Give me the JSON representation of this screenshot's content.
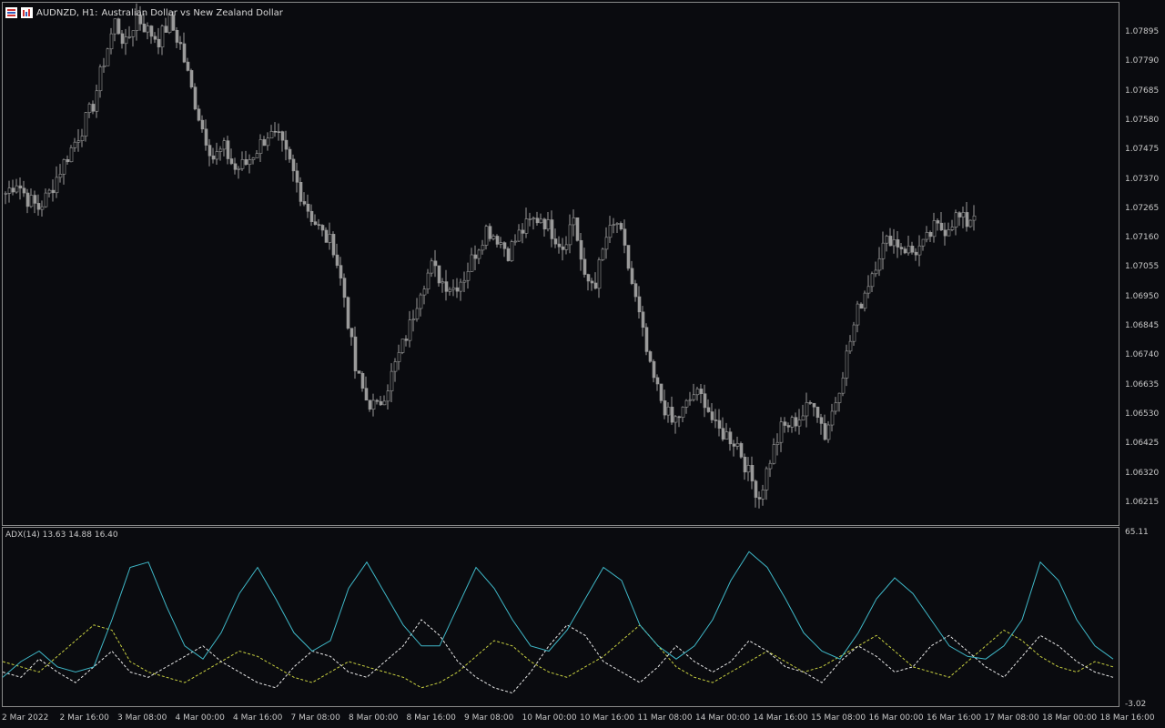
{
  "chart_header": {
    "symbol_timeframe": "AUDNZD, H1:",
    "description": "Australian Dollar vs New Zealand Dollar"
  },
  "icons": [
    "symbol-list-icon",
    "chart-type-icon"
  ],
  "colors": {
    "background": "#0a0b0f",
    "candles": "#9a9a9a",
    "adx_line": "#3fb8c8",
    "plus_di": "#e8e8e8",
    "minus_di": "#c8d040",
    "border": "#8a8a8a"
  },
  "indicator": {
    "label": "ADX(14) 13.63 14.88 16.40",
    "scale_top": "65.11",
    "scale_bottom": "-3.02"
  },
  "price_axis": [
    "1.07895",
    "1.07790",
    "1.07685",
    "1.07580",
    "1.07475",
    "1.07370",
    "1.07265",
    "1.07160",
    "1.07055",
    "1.06950",
    "1.06845",
    "1.06740",
    "1.06635",
    "1.06530",
    "1.06425",
    "1.06320",
    "1.06215"
  ],
  "time_axis": [
    "2 Mar 2022",
    "2 Mar 16:00",
    "3 Mar 08:00",
    "4 Mar 00:00",
    "4 Mar 16:00",
    "7 Mar 08:00",
    "8 Mar 00:00",
    "8 Mar 16:00",
    "9 Mar 08:00",
    "10 Mar 00:00",
    "10 Mar 16:00",
    "11 Mar 08:00",
    "14 Mar 00:00",
    "14 Mar 16:00",
    "15 Mar 08:00",
    "16 Mar 00:00",
    "16 Mar 16:00",
    "17 Mar 08:00",
    "18 Mar 00:00",
    "18 Mar 16:00"
  ],
  "chart_data": {
    "type": "line",
    "series": [
      {
        "values": [
          1.073,
          1.0734,
          1.0728,
          1.0725,
          1.073,
          1.0738,
          1.0745,
          1.0752,
          1.076,
          1.0775,
          1.0788,
          1.078,
          1.079,
          1.0785,
          1.0782,
          1.0788,
          1.078,
          1.0765,
          1.0752,
          1.0742,
          1.0745,
          1.0738,
          1.074,
          1.0745,
          1.075,
          1.0748,
          1.074,
          1.073,
          1.0722,
          1.0716,
          1.0712,
          1.0695,
          1.067,
          1.066,
          1.0657,
          1.0665,
          1.0675,
          1.0685,
          1.0698,
          1.0705,
          1.07,
          1.0698,
          1.0702,
          1.071,
          1.0718,
          1.0715,
          1.071,
          1.0716,
          1.072,
          1.0722,
          1.0717,
          1.0712,
          1.0722,
          1.07,
          1.07,
          1.0715,
          1.072,
          1.0705,
          1.0688,
          1.067,
          1.066,
          1.0652,
          1.0656,
          1.0662,
          1.066,
          1.065,
          1.0648,
          1.0645,
          1.0635,
          1.0627,
          1.064,
          1.065,
          1.0652,
          1.0655,
          1.066,
          1.0648,
          1.066,
          1.0675,
          1.069,
          1.07,
          1.071,
          1.0715,
          1.0712,
          1.071,
          1.0712,
          1.0718,
          1.0718,
          1.0722,
          1.072,
          1.0725
        ]
      },
      {
        "name": "ADX",
        "values": [
          8,
          14,
          18,
          12,
          10,
          12,
          30,
          50,
          52,
          35,
          20,
          15,
          25,
          40,
          50,
          38,
          25,
          18,
          22,
          42,
          52,
          40,
          28,
          20,
          20,
          35,
          50,
          42,
          30,
          20,
          18,
          26,
          38,
          50,
          45,
          28,
          20,
          15,
          20,
          30,
          45,
          56,
          50,
          38,
          25,
          18,
          15,
          25,
          38,
          46,
          40,
          30,
          20,
          16,
          15,
          20,
          30,
          52,
          45,
          30,
          20,
          15
        ]
      },
      {
        "name": "+DI",
        "values": [
          10,
          8,
          15,
          10,
          6,
          12,
          18,
          10,
          8,
          12,
          16,
          20,
          14,
          10,
          6,
          4,
          12,
          18,
          16,
          10,
          8,
          14,
          20,
          30,
          24,
          14,
          8,
          4,
          2,
          10,
          20,
          28,
          24,
          14,
          10,
          6,
          12,
          20,
          14,
          10,
          14,
          22,
          18,
          12,
          10,
          6,
          14,
          20,
          16,
          10,
          12,
          20,
          24,
          18,
          12,
          8,
          16,
          24,
          20,
          14,
          10,
          8
        ]
      },
      {
        "name": "-DI",
        "values": [
          14,
          12,
          10,
          16,
          22,
          28,
          26,
          14,
          10,
          8,
          6,
          10,
          14,
          18,
          16,
          12,
          8,
          6,
          10,
          14,
          12,
          10,
          8,
          4,
          6,
          10,
          16,
          22,
          20,
          14,
          10,
          8,
          12,
          16,
          22,
          28,
          20,
          12,
          8,
          6,
          10,
          14,
          18,
          14,
          10,
          12,
          16,
          20,
          24,
          18,
          12,
          10,
          8,
          14,
          20,
          26,
          22,
          16,
          12,
          10,
          14,
          12
        ]
      }
    ]
  }
}
